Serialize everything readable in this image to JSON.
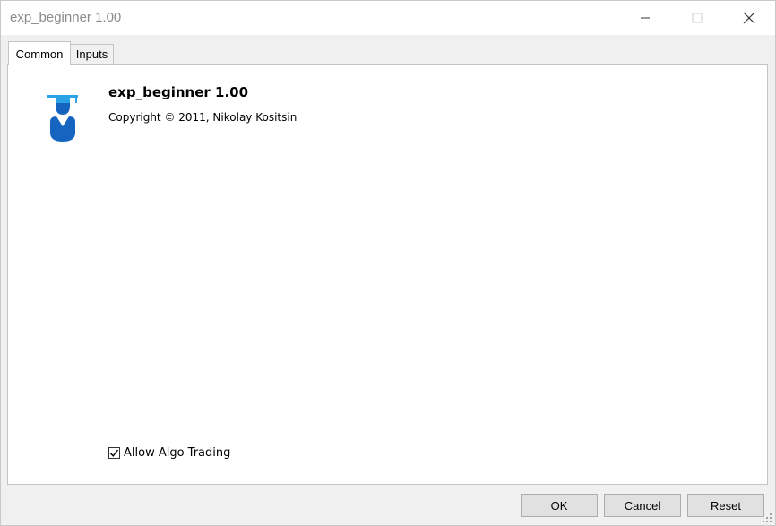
{
  "window": {
    "title": "exp_beginner 1.00"
  },
  "tabs": [
    {
      "label": "Common",
      "active": true
    },
    {
      "label": "Inputs",
      "active": false
    }
  ],
  "common": {
    "icon": "graduate-icon",
    "name": "exp_beginner 1.00",
    "copyright": "Copyright © 2011, Nikolay Kositsin",
    "allow_algo_label": "Allow Algo Trading",
    "allow_algo_checked": true
  },
  "buttons": {
    "ok": "OK",
    "cancel": "Cancel",
    "reset": "Reset"
  },
  "colors": {
    "icon_light": "#2aa3e6",
    "icon_dark": "#1565c0",
    "title_text": "#8a8a8a"
  }
}
